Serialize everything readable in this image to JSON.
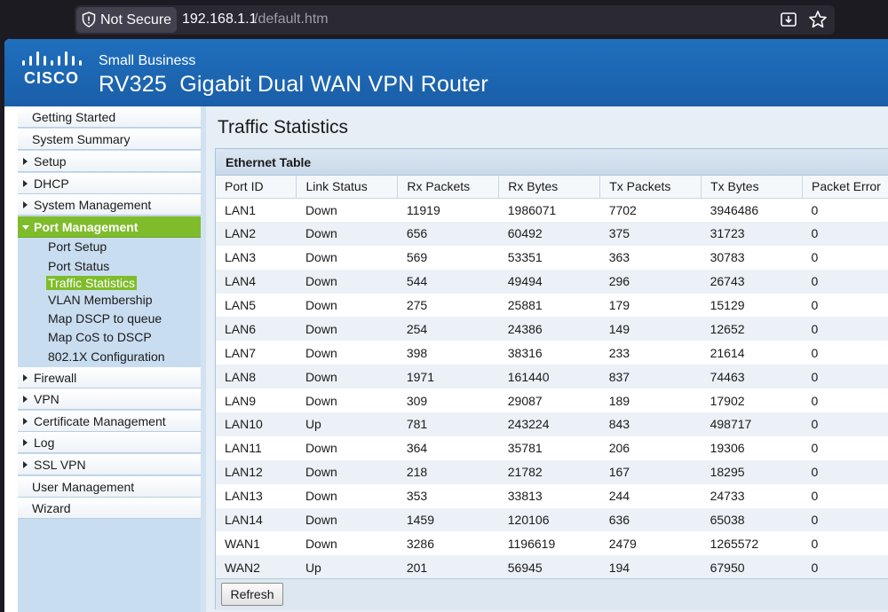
{
  "browser": {
    "security_label": "Not Secure",
    "url_host": "192.168.1.1",
    "url_path": "/default.htm"
  },
  "header": {
    "brand_small": "Small Business",
    "title": "RV325  Gigabit Dual WAN VPN Router"
  },
  "sidebar": {
    "items": [
      {
        "label": "Getting Started",
        "expandable": false
      },
      {
        "label": "System Summary",
        "expandable": false
      },
      {
        "label": "Setup",
        "expandable": true
      },
      {
        "label": "DHCP",
        "expandable": true
      },
      {
        "label": "System Management",
        "expandable": true
      },
      {
        "label": "Port Management",
        "expandable": true,
        "active": true
      },
      {
        "label": "Firewall",
        "expandable": true
      },
      {
        "label": "VPN",
        "expandable": true
      },
      {
        "label": "Certificate Management",
        "expandable": true
      },
      {
        "label": "Log",
        "expandable": true
      },
      {
        "label": "SSL VPN",
        "expandable": true
      },
      {
        "label": "User Management",
        "expandable": false
      },
      {
        "label": "Wizard",
        "expandable": false
      }
    ],
    "sub_items": [
      {
        "label": "Port Setup"
      },
      {
        "label": "Port Status"
      },
      {
        "label": "Traffic Statistics",
        "selected": true
      },
      {
        "label": "VLAN Membership"
      },
      {
        "label": "Map DSCP to queue"
      },
      {
        "label": "Map CoS to DSCP"
      },
      {
        "label": "802.1X Configuration"
      }
    ]
  },
  "main": {
    "page_title": "Traffic Statistics",
    "table_caption": "Ethernet Table",
    "columns": [
      "Port ID",
      "Link Status",
      "Rx Packets",
      "Rx Bytes",
      "Tx Packets",
      "Tx Bytes",
      "Packet Error"
    ],
    "rows": [
      [
        "LAN1",
        "Down",
        "11919",
        "1986071",
        "7702",
        "3946486",
        "0"
      ],
      [
        "LAN2",
        "Down",
        "656",
        "60492",
        "375",
        "31723",
        "0"
      ],
      [
        "LAN3",
        "Down",
        "569",
        "53351",
        "363",
        "30783",
        "0"
      ],
      [
        "LAN4",
        "Down",
        "544",
        "49494",
        "296",
        "26743",
        "0"
      ],
      [
        "LAN5",
        "Down",
        "275",
        "25881",
        "179",
        "15129",
        "0"
      ],
      [
        "LAN6",
        "Down",
        "254",
        "24386",
        "149",
        "12652",
        "0"
      ],
      [
        "LAN7",
        "Down",
        "398",
        "38316",
        "233",
        "21614",
        "0"
      ],
      [
        "LAN8",
        "Down",
        "1971",
        "161440",
        "837",
        "74463",
        "0"
      ],
      [
        "LAN9",
        "Down",
        "309",
        "29087",
        "189",
        "17902",
        "0"
      ],
      [
        "LAN10",
        "Up",
        "781",
        "243224",
        "843",
        "498717",
        "0"
      ],
      [
        "LAN11",
        "Down",
        "364",
        "35781",
        "206",
        "19306",
        "0"
      ],
      [
        "LAN12",
        "Down",
        "218",
        "21782",
        "167",
        "18295",
        "0"
      ],
      [
        "LAN13",
        "Down",
        "353",
        "33813",
        "244",
        "24733",
        "0"
      ],
      [
        "LAN14",
        "Down",
        "1459",
        "120106",
        "636",
        "65038",
        "0"
      ],
      [
        "WAN1",
        "Down",
        "3286",
        "1196619",
        "2479",
        "1265572",
        "0"
      ],
      [
        "WAN2",
        "Up",
        "201",
        "56945",
        "194",
        "67950",
        "0"
      ]
    ],
    "refresh_label": "Refresh"
  },
  "colors": {
    "header_blue": "#1a5ea8",
    "active_green": "#7fbc2b",
    "sidebar_bg": "#c9ddf0"
  }
}
